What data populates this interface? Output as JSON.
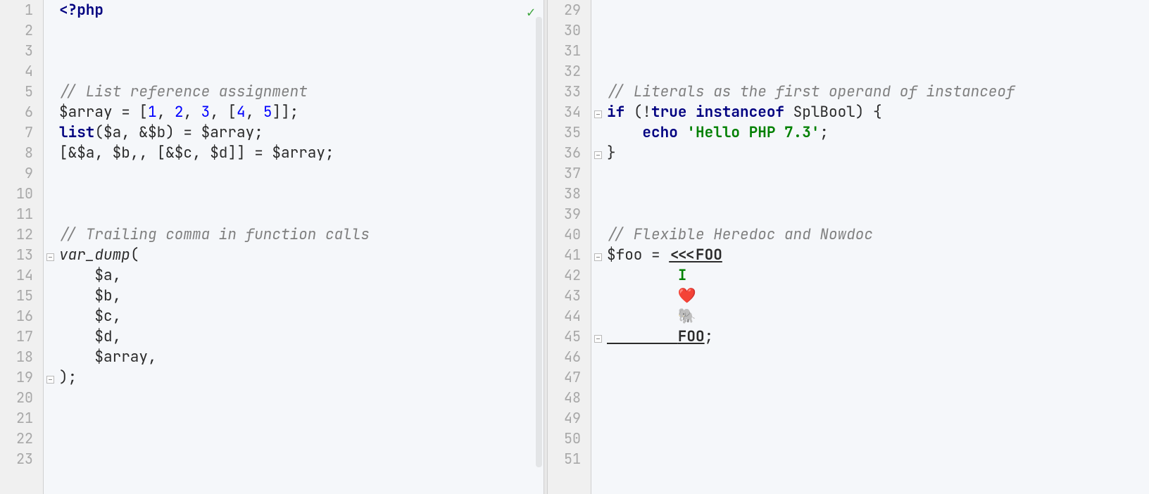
{
  "status": {
    "check": "✓"
  },
  "left": {
    "startLine": 1,
    "endLine": 23,
    "lines": {
      "1": [
        {
          "t": "<?php",
          "c": "k"
        }
      ],
      "2": [],
      "3": [],
      "4": [],
      "5": [
        {
          "t": "// List reference assignment",
          "c": "com"
        }
      ],
      "6": [
        {
          "t": "$array = ["
        },
        {
          "t": "1",
          "c": "num"
        },
        {
          "t": ", "
        },
        {
          "t": "2",
          "c": "num"
        },
        {
          "t": ", "
        },
        {
          "t": "3",
          "c": "num"
        },
        {
          "t": ", ["
        },
        {
          "t": "4",
          "c": "num"
        },
        {
          "t": ", "
        },
        {
          "t": "5",
          "c": "num"
        },
        {
          "t": "]];"
        }
      ],
      "7": [
        {
          "t": "list",
          "c": "kw"
        },
        {
          "t": "($a, &$b) = $array;"
        }
      ],
      "8": [
        {
          "t": "[&$a, $b,, [&$c, $d]] = $array;"
        }
      ],
      "9": [],
      "10": [],
      "11": [],
      "12": [
        {
          "t": "// Trailing comma in function calls",
          "c": "com"
        }
      ],
      "13": [
        {
          "t": "var_dump",
          "c": "fn"
        },
        {
          "t": "("
        }
      ],
      "14": [
        {
          "t": "    $a,"
        }
      ],
      "15": [
        {
          "t": "    $b,"
        }
      ],
      "16": [
        {
          "t": "    $c,"
        }
      ],
      "17": [
        {
          "t": "    $d,"
        }
      ],
      "18": [
        {
          "t": "    $array,"
        }
      ],
      "19": [
        {
          "t": ");"
        }
      ],
      "20": [],
      "21": [],
      "22": [],
      "23": []
    },
    "folds": {
      "13": "open",
      "19": "end"
    }
  },
  "right": {
    "startLine": 29,
    "endLine": 51,
    "lines": {
      "29": [],
      "30": [],
      "31": [],
      "32": [],
      "33": [
        {
          "t": "// Literals as the first operand of instanceof",
          "c": "com"
        }
      ],
      "34": [
        {
          "t": "if",
          "c": "kw"
        },
        {
          "t": " (!"
        },
        {
          "t": "true",
          "c": "kw"
        },
        {
          "t": " "
        },
        {
          "t": "instanceof",
          "c": "kw"
        },
        {
          "t": " SplBool) {"
        }
      ],
      "35": [
        {
          "t": "    "
        },
        {
          "t": "echo",
          "c": "kw"
        },
        {
          "t": " "
        },
        {
          "t": "'Hello PHP 7.3'",
          "c": "str"
        },
        {
          "t": ";"
        }
      ],
      "36": [
        {
          "t": "}"
        }
      ],
      "37": [],
      "38": [],
      "39": [],
      "40": [
        {
          "t": "// Flexible Heredoc and Nowdoc",
          "c": "com"
        }
      ],
      "41": [
        {
          "t": "$foo = "
        },
        {
          "t": "<<<FOO",
          "c": "heredoc-marker"
        }
      ],
      "42": [
        {
          "t": "        "
        },
        {
          "t": "I",
          "c": "str"
        }
      ],
      "43": [
        {
          "t": "        ❤️"
        }
      ],
      "44": [
        {
          "t": "        🐘"
        }
      ],
      "45": [
        {
          "t": "        ",
          "c": "heredoc-under"
        },
        {
          "t": "FOO",
          "c": "heredoc-marker"
        },
        {
          "t": ";"
        }
      ],
      "46": [],
      "47": [],
      "48": [],
      "49": [],
      "50": [],
      "51": []
    },
    "folds": {
      "34": "open",
      "36": "end",
      "41": "open",
      "45": "end"
    }
  }
}
